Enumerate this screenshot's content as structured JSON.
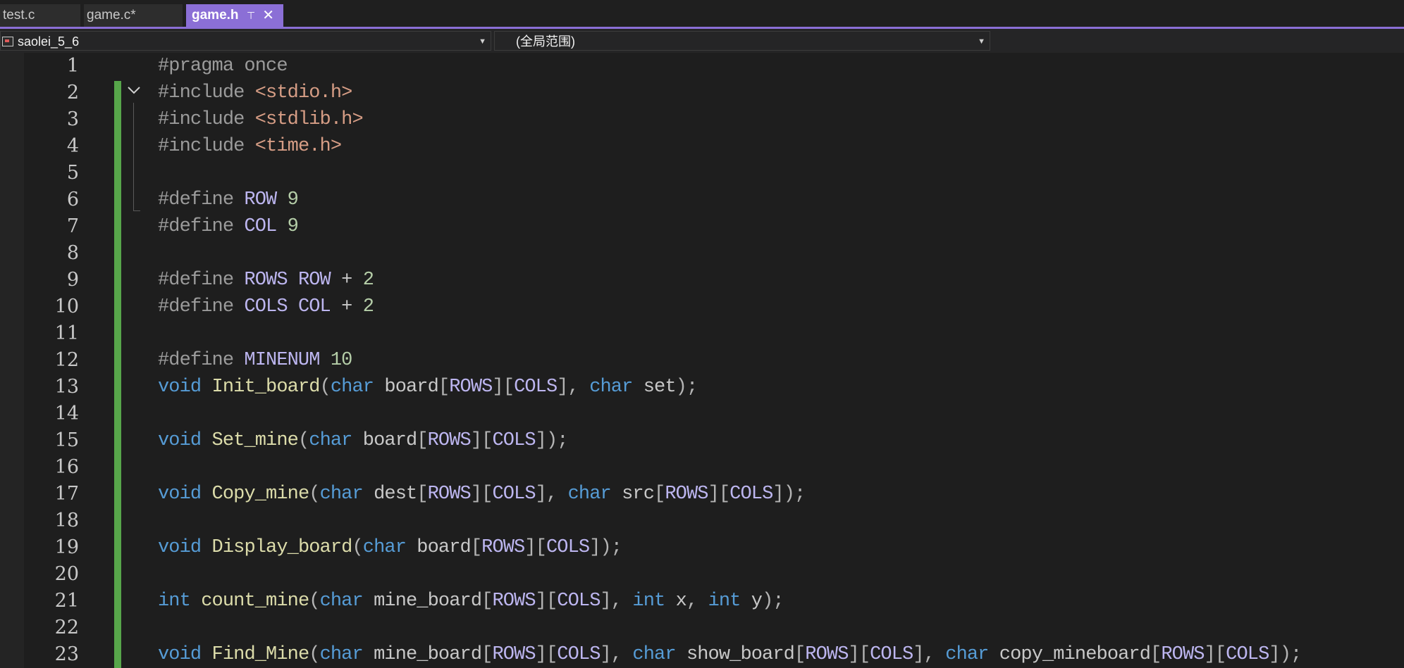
{
  "tabs": [
    {
      "label": "test.c",
      "active": false
    },
    {
      "label": "game.c*",
      "active": false
    },
    {
      "label": "game.h",
      "active": true
    }
  ],
  "navbar": {
    "project": "saolei_5_6",
    "scope": "(全局范围)"
  },
  "colors": {
    "accent": "#8b6fd6",
    "change_bar": "#57a64a",
    "keyword": "#569cd6",
    "macro": "#bdb6f0",
    "string": "#d69d85",
    "function": "#dcdcaa",
    "number": "#b5cea8"
  },
  "icons": {
    "pin": "pin-icon",
    "close": "close-icon",
    "fold": "collapse-chevron-icon"
  },
  "editor": {
    "lines": [
      {
        "n": "1",
        "tokens": [
          [
            "pre",
            "#pragma once"
          ]
        ]
      },
      {
        "n": "2",
        "tokens": [
          [
            "pre",
            "#include "
          ],
          [
            "str",
            "<stdio.h>"
          ]
        ]
      },
      {
        "n": "3",
        "tokens": [
          [
            "pre",
            "#include "
          ],
          [
            "str",
            "<stdlib.h>"
          ]
        ]
      },
      {
        "n": "4",
        "tokens": [
          [
            "pre",
            "#include "
          ],
          [
            "str",
            "<time.h>"
          ]
        ]
      },
      {
        "n": "5",
        "tokens": []
      },
      {
        "n": "6",
        "tokens": [
          [
            "pre",
            "#define "
          ],
          [
            "mac",
            "ROW"
          ],
          [
            "plain",
            " "
          ],
          [
            "num",
            "9"
          ]
        ]
      },
      {
        "n": "7",
        "tokens": [
          [
            "pre",
            "#define "
          ],
          [
            "mac",
            "COL"
          ],
          [
            "plain",
            " "
          ],
          [
            "num",
            "9"
          ]
        ]
      },
      {
        "n": "8",
        "tokens": []
      },
      {
        "n": "9",
        "tokens": [
          [
            "pre",
            "#define "
          ],
          [
            "mac",
            "ROWS"
          ],
          [
            "plain",
            " "
          ],
          [
            "mac",
            "ROW"
          ],
          [
            "plain",
            " + "
          ],
          [
            "num",
            "2"
          ]
        ]
      },
      {
        "n": "10",
        "tokens": [
          [
            "pre",
            "#define "
          ],
          [
            "mac",
            "COLS"
          ],
          [
            "plain",
            " "
          ],
          [
            "mac",
            "COL"
          ],
          [
            "plain",
            " + "
          ],
          [
            "num",
            "2"
          ]
        ]
      },
      {
        "n": "11",
        "tokens": []
      },
      {
        "n": "12",
        "tokens": [
          [
            "pre",
            "#define "
          ],
          [
            "mac",
            "MINENUM"
          ],
          [
            "plain",
            " "
          ],
          [
            "num",
            "10"
          ]
        ]
      },
      {
        "n": "13",
        "tokens": [
          [
            "kw",
            "void"
          ],
          [
            "plain",
            " "
          ],
          [
            "fn",
            "Init_board"
          ],
          [
            "punc",
            "("
          ],
          [
            "kw",
            "char"
          ],
          [
            "plain",
            " board"
          ],
          [
            "punc",
            "["
          ],
          [
            "mac",
            "ROWS"
          ],
          [
            "punc",
            "]["
          ],
          [
            "mac",
            "COLS"
          ],
          [
            "punc",
            "], "
          ],
          [
            "kw",
            "char"
          ],
          [
            "plain",
            " set"
          ],
          [
            "punc",
            ");"
          ]
        ]
      },
      {
        "n": "14",
        "tokens": []
      },
      {
        "n": "15",
        "tokens": [
          [
            "kw",
            "void"
          ],
          [
            "plain",
            " "
          ],
          [
            "fn",
            "Set_mine"
          ],
          [
            "punc",
            "("
          ],
          [
            "kw",
            "char"
          ],
          [
            "plain",
            " board"
          ],
          [
            "punc",
            "["
          ],
          [
            "mac",
            "ROWS"
          ],
          [
            "punc",
            "]["
          ],
          [
            "mac",
            "COLS"
          ],
          [
            "punc",
            "]);"
          ]
        ]
      },
      {
        "n": "16",
        "tokens": []
      },
      {
        "n": "17",
        "tokens": [
          [
            "kw",
            "void"
          ],
          [
            "plain",
            " "
          ],
          [
            "fn",
            "Copy_mine"
          ],
          [
            "punc",
            "("
          ],
          [
            "kw",
            "char"
          ],
          [
            "plain",
            " dest"
          ],
          [
            "punc",
            "["
          ],
          [
            "mac",
            "ROWS"
          ],
          [
            "punc",
            "]["
          ],
          [
            "mac",
            "COLS"
          ],
          [
            "punc",
            "], "
          ],
          [
            "kw",
            "char"
          ],
          [
            "plain",
            " src"
          ],
          [
            "punc",
            "["
          ],
          [
            "mac",
            "ROWS"
          ],
          [
            "punc",
            "]["
          ],
          [
            "mac",
            "COLS"
          ],
          [
            "punc",
            "]);"
          ]
        ]
      },
      {
        "n": "18",
        "tokens": []
      },
      {
        "n": "19",
        "tokens": [
          [
            "kw",
            "void"
          ],
          [
            "plain",
            " "
          ],
          [
            "fn",
            "Display_board"
          ],
          [
            "punc",
            "("
          ],
          [
            "kw",
            "char"
          ],
          [
            "plain",
            " board"
          ],
          [
            "punc",
            "["
          ],
          [
            "mac",
            "ROWS"
          ],
          [
            "punc",
            "]["
          ],
          [
            "mac",
            "COLS"
          ],
          [
            "punc",
            "]);"
          ]
        ]
      },
      {
        "n": "20",
        "tokens": []
      },
      {
        "n": "21",
        "tokens": [
          [
            "kw",
            "int"
          ],
          [
            "plain",
            " "
          ],
          [
            "fn",
            "count_mine"
          ],
          [
            "punc",
            "("
          ],
          [
            "kw",
            "char"
          ],
          [
            "plain",
            " mine_board"
          ],
          [
            "punc",
            "["
          ],
          [
            "mac",
            "ROWS"
          ],
          [
            "punc",
            "]["
          ],
          [
            "mac",
            "COLS"
          ],
          [
            "punc",
            "], "
          ],
          [
            "kw",
            "int"
          ],
          [
            "plain",
            " x"
          ],
          [
            "punc",
            ", "
          ],
          [
            "kw",
            "int"
          ],
          [
            "plain",
            " y"
          ],
          [
            "punc",
            ");"
          ]
        ]
      },
      {
        "n": "22",
        "tokens": []
      },
      {
        "n": "23",
        "tokens": [
          [
            "kw",
            "void"
          ],
          [
            "plain",
            " "
          ],
          [
            "fn",
            "Find_Mine"
          ],
          [
            "punc",
            "("
          ],
          [
            "kw",
            "char"
          ],
          [
            "plain",
            " mine_board"
          ],
          [
            "punc",
            "["
          ],
          [
            "mac",
            "ROWS"
          ],
          [
            "punc",
            "]["
          ],
          [
            "mac",
            "COLS"
          ],
          [
            "punc",
            "], "
          ],
          [
            "kw",
            "char"
          ],
          [
            "plain",
            " show_board"
          ],
          [
            "punc",
            "["
          ],
          [
            "mac",
            "ROWS"
          ],
          [
            "punc",
            "]["
          ],
          [
            "mac",
            "COLS"
          ],
          [
            "punc",
            "], "
          ],
          [
            "kw",
            "char"
          ],
          [
            "plain",
            " copy_mineboard"
          ],
          [
            "punc",
            "["
          ],
          [
            "mac",
            "ROWS"
          ],
          [
            "punc",
            "]["
          ],
          [
            "mac",
            "COLS"
          ],
          [
            "punc",
            "]);"
          ]
        ]
      }
    ]
  }
}
